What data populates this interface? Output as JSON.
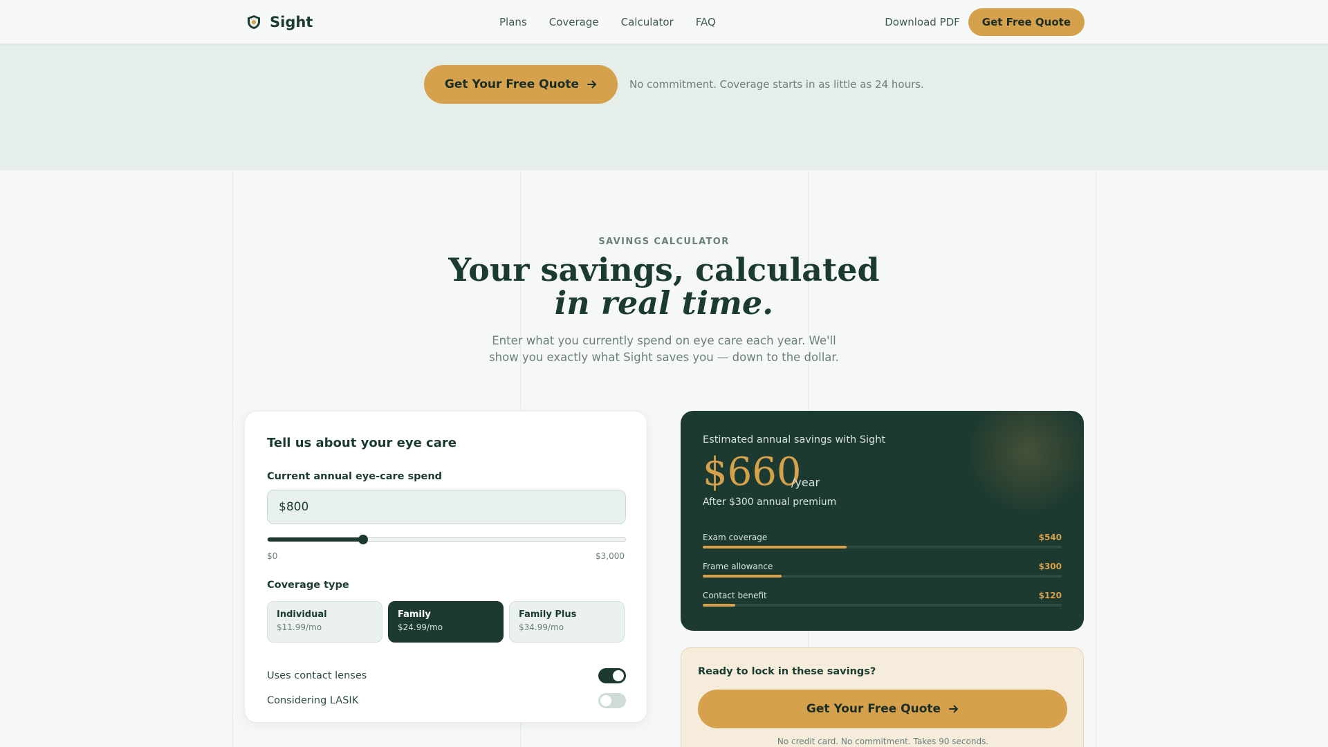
{
  "header": {
    "brand": "Sight",
    "nav": [
      "Plans",
      "Coverage",
      "Calculator",
      "FAQ"
    ],
    "download_label": "Download PDF",
    "quote_label": "Get Free Quote"
  },
  "hero": {
    "cta_label": "Get Your Free Quote",
    "note": "No commitment. Coverage starts in as little as 24 hours."
  },
  "section": {
    "eyebrow": "SAVINGS CALCULATOR",
    "title_line1": "Your savings, calculated",
    "title_line2": "in real time.",
    "subtitle": "Enter what you currently spend on eye care each year. We'll show you exactly what Sight saves you — down to the dollar."
  },
  "form": {
    "title": "Tell us about your eye care",
    "spend_label": "Current annual eye-care spend",
    "spend_value": "$800",
    "slider": {
      "min_label": "$0",
      "max_label": "$3,000",
      "min": 0,
      "max": 3000,
      "value": 800
    },
    "coverage_label": "Coverage type",
    "plans": [
      {
        "name": "Individual",
        "price": "$11.99/mo",
        "selected": false
      },
      {
        "name": "Family",
        "price": "$24.99/mo",
        "selected": true
      },
      {
        "name": "Family Plus",
        "price": "$34.99/mo",
        "selected": false
      }
    ],
    "toggles": [
      {
        "label": "Uses contact lenses",
        "on": true
      },
      {
        "label": "Considering LASIK",
        "on": false
      }
    ]
  },
  "results": {
    "label": "Estimated annual savings with Sight",
    "amount": "$660",
    "unit": "/year",
    "after": "After $300 annual premium",
    "breakdown": [
      {
        "label": "Exam coverage",
        "value": "$540",
        "fraction": 0.4
      },
      {
        "label": "Frame allowance",
        "value": "$300",
        "fraction": 0.22
      },
      {
        "label": "Contact benefit",
        "value": "$120",
        "fraction": 0.09
      }
    ]
  },
  "cta": {
    "question": "Ready to lock in these savings?",
    "button_label": "Get Your Free Quote",
    "note": "No credit card. No commitment. Takes 90 seconds."
  },
  "colors": {
    "accent_gold": "#d6a14d",
    "brand_green": "#1d3a30",
    "hero_band": "#e6eeea"
  }
}
